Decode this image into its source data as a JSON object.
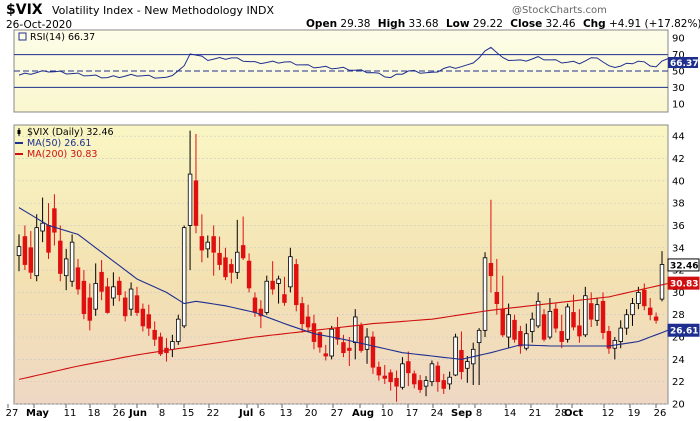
{
  "header": {
    "symbol": "$VIX",
    "name": "Volatility Index - New Methodology",
    "exchange": "INDX",
    "date": "26-Oct-2020",
    "open_label": "Open",
    "open": "29.38",
    "high_label": "High",
    "high": "33.68",
    "low_label": "Low",
    "low": "29.22",
    "close_label": "Close",
    "close": "32.46",
    "chg_label": "Chg",
    "chg": "+4.91 (+17.82%)",
    "watermark": "@StockCharts.com"
  },
  "rsi_panel": {
    "label": "RSI(14) 66.37",
    "value_tag": "66.37",
    "ticks": [
      "90",
      "70",
      "50",
      "30",
      "10"
    ]
  },
  "price_panel": {
    "legend": [
      {
        "label": "$VIX (Daily) 32.46",
        "color": "#000000"
      },
      {
        "label": "MA(50) 26.61",
        "color": "#1f2f8f"
      },
      {
        "label": "MA(200) 30.83",
        "color": "#d01010"
      }
    ],
    "y_ticks": [
      "44",
      "42",
      "40",
      "38",
      "36",
      "34",
      "32",
      "30",
      "28",
      "26",
      "24",
      "22",
      "20"
    ],
    "tags": [
      {
        "text": "32.46",
        "color": "#000000"
      },
      {
        "text": "30.83",
        "color": "#d01010"
      },
      {
        "text": "26.61",
        "color": "#1f2f8f"
      }
    ]
  },
  "x_axis": {
    "labels": [
      "27",
      "May",
      "11",
      "18",
      "26",
      "Jun",
      "8",
      "15",
      "22",
      "Jul",
      "6",
      "13",
      "20",
      "27",
      "Aug",
      "10",
      "17",
      "24",
      "Sep",
      "8",
      "14",
      "21",
      "28",
      "Oct",
      "12",
      "19",
      "26"
    ]
  },
  "colors": {
    "up": "#000000",
    "down": "#e01010",
    "ma50": "#1f2f8f",
    "ma200": "#d01010",
    "rsi": "#1f2f8f",
    "grid": "#c9c9c9"
  },
  "chart_data": {
    "type": "candlestick",
    "title": "$VIX Volatility Index - New Methodology INDX",
    "date_range": [
      "2020-04-27",
      "2020-10-26"
    ],
    "ylim": [
      20,
      45
    ],
    "rsi_ylim": [
      0,
      100
    ],
    "series": [
      {
        "name": "$VIX (Daily)",
        "last": 32.46
      },
      {
        "name": "MA(50)",
        "last": 26.61
      },
      {
        "name": "MA(200)",
        "last": 30.83
      },
      {
        "name": "RSI(14)",
        "last": 66.37
      }
    ],
    "ohlc": [
      [
        33.3,
        35.2,
        31.9,
        34.1
      ],
      [
        35.0,
        36.0,
        32.0,
        32.5
      ],
      [
        34.0,
        35.5,
        31.2,
        31.8
      ],
      [
        31.5,
        37.0,
        31.0,
        35.8
      ],
      [
        35.5,
        38.5,
        34.5,
        36.2
      ],
      [
        36.0,
        38.0,
        33.0,
        33.6
      ],
      [
        37.5,
        38.8,
        34.2,
        35.4
      ],
      [
        34.6,
        36.0,
        31.0,
        31.7
      ],
      [
        31.5,
        33.9,
        30.2,
        33.0
      ],
      [
        31.0,
        35.2,
        30.5,
        34.5
      ],
      [
        32.2,
        33.0,
        29.8,
        30.3
      ],
      [
        31.0,
        32.0,
        27.6,
        28.1
      ],
      [
        29.5,
        30.8,
        26.6,
        27.5
      ],
      [
        28.5,
        32.6,
        27.9,
        30.8
      ],
      [
        31.8,
        32.9,
        29.3,
        30.1
      ],
      [
        30.5,
        31.3,
        28.1,
        28.2
      ],
      [
        29.5,
        31.8,
        28.8,
        30.5
      ],
      [
        31.0,
        31.4,
        29.2,
        29.8
      ],
      [
        29.5,
        30.1,
        27.4,
        27.9
      ],
      [
        28.5,
        30.9,
        27.9,
        30.3
      ],
      [
        29.7,
        30.5,
        27.9,
        28.2
      ],
      [
        28.5,
        29.0,
        26.5,
        27.0
      ],
      [
        28.0,
        28.9,
        26.1,
        26.8
      ],
      [
        26.6,
        27.4,
        25.2,
        25.8
      ],
      [
        26.0,
        26.4,
        24.3,
        24.5
      ],
      [
        25.0,
        25.9,
        23.8,
        24.6
      ],
      [
        24.9,
        26.2,
        24.2,
        25.6
      ],
      [
        25.6,
        28.0,
        25.3,
        27.6
      ],
      [
        27.0,
        36.0,
        26.8,
        35.8
      ],
      [
        36.0,
        44.5,
        32.0,
        40.6
      ],
      [
        40.0,
        44.2,
        35.3,
        36.0
      ],
      [
        35.0,
        37.0,
        32.7,
        33.8
      ],
      [
        33.9,
        35.1,
        33.1,
        34.5
      ],
      [
        35.0,
        36.0,
        31.5,
        33.6
      ],
      [
        33.5,
        35.0,
        32.0,
        32.5
      ],
      [
        33.1,
        34.0,
        31.1,
        31.4
      ],
      [
        32.5,
        33.0,
        30.8,
        31.8
      ],
      [
        31.8,
        36.5,
        31.2,
        33.6
      ],
      [
        34.2,
        36.8,
        32.9,
        33.1
      ],
      [
        32.8,
        33.5,
        30.0,
        30.4
      ],
      [
        29.5,
        30.0,
        27.8,
        28.2
      ],
      [
        28.5,
        29.3,
        26.8,
        27.9
      ],
      [
        28.2,
        31.5,
        28.0,
        31.0
      ],
      [
        31.0,
        32.8,
        29.8,
        30.3
      ],
      [
        30.8,
        31.5,
        29.0,
        31.2
      ],
      [
        29.8,
        31.4,
        28.8,
        29.1
      ],
      [
        30.5,
        34.0,
        30.0,
        33.2
      ],
      [
        32.5,
        33.0,
        28.3,
        28.9
      ],
      [
        29.0,
        29.6,
        26.4,
        27.2
      ],
      [
        27.8,
        28.9,
        26.4,
        26.9
      ],
      [
        27.2,
        28.0,
        24.9,
        25.6
      ],
      [
        26.4,
        26.5,
        24.6,
        25.1
      ],
      [
        24.5,
        25.3,
        23.9,
        24.3
      ],
      [
        24.3,
        27.0,
        24.0,
        26.7
      ],
      [
        26.8,
        27.8,
        25.3,
        25.8
      ],
      [
        25.5,
        26.2,
        24.2,
        24.6
      ],
      [
        25.0,
        26.0,
        23.4,
        24.8
      ],
      [
        25.5,
        28.5,
        24.0,
        27.8
      ],
      [
        27.0,
        27.3,
        24.6,
        24.8
      ],
      [
        24.9,
        26.8,
        23.6,
        26.0
      ],
      [
        26.0,
        26.5,
        22.7,
        23.3
      ],
      [
        23.3,
        23.8,
        22.1,
        22.6
      ],
      [
        22.5,
        23.5,
        21.8,
        22.3
      ],
      [
        22.8,
        23.1,
        21.2,
        22.0
      ],
      [
        22.3,
        23.0,
        20.2,
        21.6
      ],
      [
        21.5,
        24.2,
        21.3,
        23.6
      ],
      [
        23.8,
        24.7,
        21.6,
        22.8
      ],
      [
        22.7,
        23.0,
        21.4,
        21.8
      ],
      [
        22.1,
        22.6,
        21.0,
        21.3
      ],
      [
        21.6,
        22.5,
        20.7,
        22.1
      ],
      [
        22.0,
        23.9,
        21.6,
        23.6
      ],
      [
        23.4,
        23.8,
        21.1,
        22.0
      ],
      [
        22.1,
        22.7,
        20.9,
        21.4
      ],
      [
        21.8,
        22.9,
        21.3,
        22.4
      ],
      [
        22.6,
        26.3,
        22.5,
        26.0
      ],
      [
        24.8,
        26.5,
        22.2,
        22.9
      ],
      [
        23.2,
        24.3,
        21.9,
        23.8
      ],
      [
        23.6,
        25.5,
        21.7,
        24.9
      ],
      [
        25.5,
        26.8,
        21.7,
        26.6
      ],
      [
        26.6,
        33.6,
        26.0,
        33.1
      ],
      [
        32.6,
        38.3,
        30.0,
        31.5
      ],
      [
        30.0,
        33.0,
        28.0,
        29.0
      ],
      [
        28.5,
        31.5,
        26.0,
        26.2
      ],
      [
        26.0,
        29.0,
        25.0,
        28.0
      ],
      [
        27.5,
        28.0,
        25.5,
        25.8
      ],
      [
        26.5,
        27.0,
        24.5,
        25.2
      ],
      [
        25.0,
        27.2,
        24.8,
        26.3
      ],
      [
        26.5,
        28.2,
        25.5,
        27.6
      ],
      [
        27.0,
        30.0,
        26.8,
        29.2
      ],
      [
        28.0,
        28.5,
        25.6,
        25.8
      ],
      [
        26.0,
        29.5,
        25.8,
        28.3
      ],
      [
        28.5,
        29.0,
        26.4,
        26.8
      ],
      [
        26.5,
        28.0,
        25.0,
        25.6
      ],
      [
        25.8,
        29.0,
        25.5,
        28.7
      ],
      [
        28.2,
        29.8,
        26.6,
        26.9
      ],
      [
        27.0,
        28.5,
        25.5,
        26.1
      ],
      [
        26.2,
        30.5,
        26.0,
        29.7
      ],
      [
        29.0,
        30.0,
        26.9,
        27.6
      ],
      [
        27.5,
        29.5,
        27.0,
        28.9
      ],
      [
        29.2,
        30.0,
        25.8,
        26.4
      ],
      [
        26.5,
        27.0,
        24.5,
        25.0
      ],
      [
        25.0,
        26.0,
        24.0,
        25.7
      ],
      [
        25.6,
        27.5,
        25.0,
        26.8
      ],
      [
        26.8,
        28.5,
        26.2,
        28.0
      ],
      [
        28.0,
        29.5,
        27.0,
        29.0
      ],
      [
        29.0,
        30.5,
        28.5,
        30.0
      ],
      [
        30.2,
        30.8,
        28.4,
        28.8
      ],
      [
        28.6,
        29.5,
        27.5,
        28.0
      ],
      [
        27.8,
        28.2,
        27.2,
        27.5
      ],
      [
        29.4,
        33.7,
        29.2,
        32.5
      ]
    ],
    "ma50": [
      [
        0,
        37.6
      ],
      [
        5,
        36.0
      ],
      [
        10,
        35.2
      ],
      [
        15,
        33.2
      ],
      [
        20,
        31.2
      ],
      [
        25,
        30.0
      ],
      [
        28,
        29.0
      ],
      [
        30,
        29.2
      ],
      [
        35,
        28.8
      ],
      [
        40,
        28.2
      ],
      [
        45,
        27.2
      ],
      [
        50,
        26.3
      ],
      [
        55,
        25.8
      ],
      [
        60,
        25.2
      ],
      [
        65,
        24.6
      ],
      [
        70,
        24.3
      ],
      [
        75,
        24.0
      ],
      [
        80,
        24.6
      ],
      [
        85,
        25.3
      ],
      [
        90,
        25.2
      ],
      [
        95,
        25.2
      ],
      [
        100,
        25.2
      ],
      [
        105,
        25.6
      ],
      [
        110,
        26.6
      ]
    ],
    "ma200": [
      [
        0,
        22.2
      ],
      [
        10,
        23.4
      ],
      [
        20,
        24.4
      ],
      [
        30,
        25.2
      ],
      [
        40,
        26.0
      ],
      [
        50,
        26.6
      ],
      [
        60,
        27.2
      ],
      [
        70,
        27.6
      ],
      [
        80,
        28.4
      ],
      [
        90,
        29.0
      ],
      [
        100,
        29.6
      ],
      [
        110,
        30.8
      ]
    ],
    "rsi": [
      [
        0,
        45
      ],
      [
        5,
        50
      ],
      [
        10,
        46
      ],
      [
        15,
        42
      ],
      [
        20,
        45
      ],
      [
        25,
        41
      ],
      [
        28,
        55
      ],
      [
        29,
        72
      ],
      [
        32,
        64
      ],
      [
        36,
        66
      ],
      [
        40,
        60
      ],
      [
        45,
        61
      ],
      [
        50,
        55
      ],
      [
        55,
        53
      ],
      [
        60,
        48
      ],
      [
        63,
        42
      ],
      [
        66,
        50
      ],
      [
        70,
        47
      ],
      [
        72,
        53
      ],
      [
        76,
        56
      ],
      [
        78,
        66
      ],
      [
        80,
        80
      ],
      [
        82,
        65
      ],
      [
        85,
        62
      ],
      [
        88,
        66
      ],
      [
        92,
        61
      ],
      [
        95,
        60
      ],
      [
        98,
        67
      ],
      [
        100,
        55
      ],
      [
        102,
        56
      ],
      [
        105,
        62
      ],
      [
        108,
        55
      ],
      [
        110,
        66.37
      ]
    ]
  }
}
